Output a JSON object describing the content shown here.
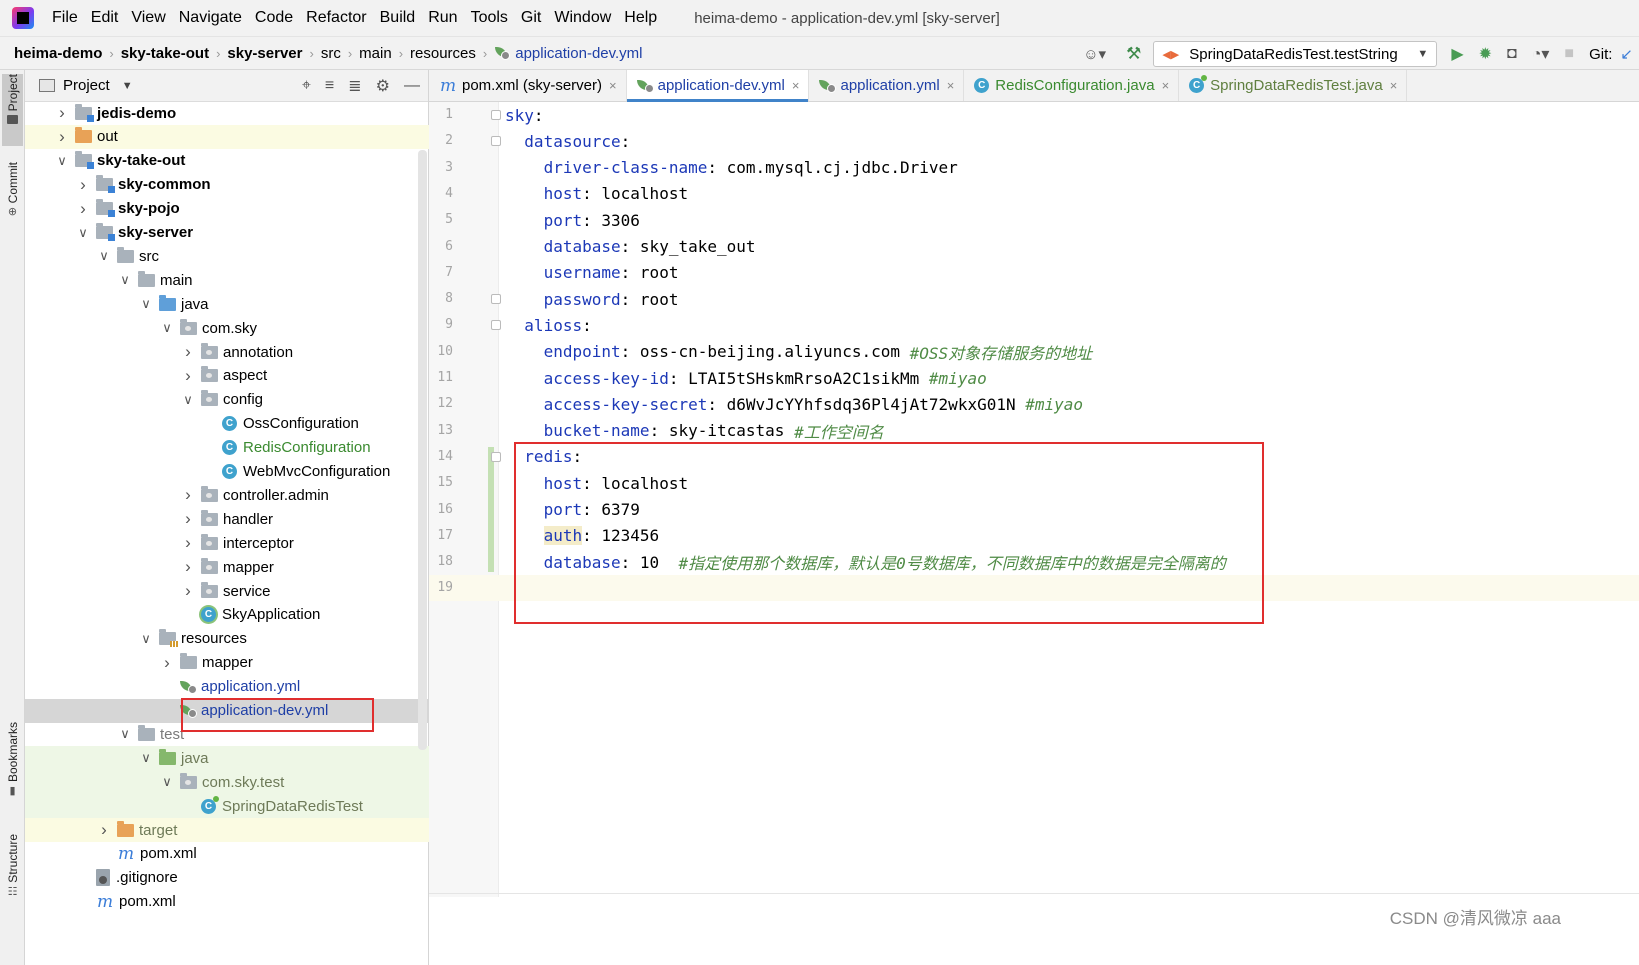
{
  "menubar": {
    "items": [
      "File",
      "Edit",
      "View",
      "Navigate",
      "Code",
      "Refactor",
      "Build",
      "Run",
      "Tools",
      "Git",
      "Window",
      "Help"
    ],
    "window_title": "heima-demo - application-dev.yml [sky-server]"
  },
  "navbar": {
    "breadcrumbs": [
      "heima-demo",
      "sky-take-out",
      "sky-server",
      "src",
      "main",
      "resources",
      "application-dev.yml"
    ],
    "run_config": "SpringDataRedisTest.testString",
    "git_label": "Git:"
  },
  "toolstrip": {
    "project": "Project",
    "commit": "Commit",
    "bookmarks": "Bookmarks",
    "structure": "Structure"
  },
  "project_panel": {
    "title": "Project",
    "tree": [
      {
        "label": "jedis-demo",
        "depth": 0,
        "arrow": "right",
        "icon": "module-folder",
        "style": "bold"
      },
      {
        "label": "out",
        "depth": 0,
        "arrow": "right",
        "icon": "orange-folder",
        "style": "normal",
        "bg": "yellow"
      },
      {
        "label": "sky-take-out",
        "depth": 0,
        "arrow": "down",
        "icon": "module-folder",
        "style": "bold"
      },
      {
        "label": "sky-common",
        "depth": 1,
        "arrow": "right",
        "icon": "module-folder",
        "style": "bold"
      },
      {
        "label": "sky-pojo",
        "depth": 1,
        "arrow": "right",
        "icon": "module-folder",
        "style": "bold"
      },
      {
        "label": "sky-server",
        "depth": 1,
        "arrow": "down",
        "icon": "module-folder",
        "style": "bold"
      },
      {
        "label": "src",
        "depth": 2,
        "arrow": "down",
        "icon": "folder",
        "style": "normal"
      },
      {
        "label": "main",
        "depth": 3,
        "arrow": "down",
        "icon": "folder",
        "style": "normal"
      },
      {
        "label": "java",
        "depth": 4,
        "arrow": "down",
        "icon": "blue-folder",
        "style": "normal"
      },
      {
        "label": "com.sky",
        "depth": 5,
        "arrow": "down",
        "icon": "package",
        "style": "normal"
      },
      {
        "label": "annotation",
        "depth": 6,
        "arrow": "right",
        "icon": "package",
        "style": "normal"
      },
      {
        "label": "aspect",
        "depth": 6,
        "arrow": "right",
        "icon": "package",
        "style": "normal"
      },
      {
        "label": "config",
        "depth": 6,
        "arrow": "down",
        "icon": "package",
        "style": "normal"
      },
      {
        "label": "OssConfiguration",
        "depth": 7,
        "arrow": "none",
        "icon": "class",
        "style": "normal"
      },
      {
        "label": "RedisConfiguration",
        "depth": 7,
        "arrow": "none",
        "icon": "class",
        "style": "green"
      },
      {
        "label": "WebMvcConfiguration",
        "depth": 7,
        "arrow": "none",
        "icon": "class",
        "style": "normal"
      },
      {
        "label": "controller.admin",
        "depth": 6,
        "arrow": "right",
        "icon": "package",
        "style": "normal"
      },
      {
        "label": "handler",
        "depth": 6,
        "arrow": "right",
        "icon": "package",
        "style": "normal"
      },
      {
        "label": "interceptor",
        "depth": 6,
        "arrow": "right",
        "icon": "package",
        "style": "normal"
      },
      {
        "label": "mapper",
        "depth": 6,
        "arrow": "right",
        "icon": "package",
        "style": "normal"
      },
      {
        "label": "service",
        "depth": 6,
        "arrow": "right",
        "icon": "package",
        "style": "normal"
      },
      {
        "label": "SkyApplication",
        "depth": 6,
        "arrow": "none",
        "icon": "spring-class",
        "style": "normal"
      },
      {
        "label": "resources",
        "depth": 4,
        "arrow": "down",
        "icon": "resources-folder",
        "style": "normal"
      },
      {
        "label": "mapper",
        "depth": 5,
        "arrow": "right",
        "icon": "folder",
        "style": "normal"
      },
      {
        "label": "application.yml",
        "depth": 5,
        "arrow": "none",
        "icon": "yml",
        "style": "blue"
      },
      {
        "label": "application-dev.yml",
        "depth": 5,
        "arrow": "none",
        "icon": "yml",
        "style": "blue",
        "bg": "selected"
      },
      {
        "label": "test",
        "depth": 3,
        "arrow": "down",
        "icon": "folder",
        "style": "gray"
      },
      {
        "label": "java",
        "depth": 4,
        "arrow": "down",
        "icon": "green-folder",
        "style": "olive",
        "bg": "green"
      },
      {
        "label": "com.sky.test",
        "depth": 5,
        "arrow": "down",
        "icon": "package",
        "style": "olive",
        "bg": "green"
      },
      {
        "label": "SpringDataRedisTest",
        "depth": 6,
        "arrow": "none",
        "icon": "test-class",
        "style": "olive",
        "bg": "green"
      },
      {
        "label": "target",
        "depth": 2,
        "arrow": "right",
        "icon": "orange-folder",
        "style": "olive",
        "bg": "yellow"
      },
      {
        "label": "pom.xml",
        "depth": 2,
        "arrow": "none",
        "icon": "maven",
        "style": "normal"
      },
      {
        "label": ".gitignore",
        "depth": 1,
        "arrow": "none",
        "icon": "gitignore",
        "style": "normal"
      },
      {
        "label": "pom.xml",
        "depth": 1,
        "arrow": "none",
        "icon": "maven",
        "style": "normal"
      }
    ]
  },
  "tabs": [
    {
      "label": "pom.xml (sky-server)",
      "icon": "maven",
      "style": "normal",
      "active": false
    },
    {
      "label": "application-dev.yml",
      "icon": "yml",
      "style": "blue",
      "active": true
    },
    {
      "label": "application.yml",
      "icon": "yml",
      "style": "blue",
      "active": false
    },
    {
      "label": "RedisConfiguration.java",
      "icon": "class",
      "style": "green",
      "active": false
    },
    {
      "label": "SpringDataRedisTest.java",
      "icon": "test-class",
      "style": "olive",
      "active": false
    }
  ],
  "editor": {
    "lines": [
      {
        "n": "1",
        "indent": 0,
        "key": "sky",
        "sep": ":",
        "value": "",
        "comment": ""
      },
      {
        "n": "2",
        "indent": 1,
        "key": "datasource",
        "sep": ":",
        "value": "",
        "comment": ""
      },
      {
        "n": "3",
        "indent": 2,
        "key": "driver-class-name",
        "sep": ": ",
        "value": "com.mysql.cj.jdbc.Driver",
        "comment": ""
      },
      {
        "n": "4",
        "indent": 2,
        "key": "host",
        "sep": ": ",
        "value": "localhost",
        "comment": ""
      },
      {
        "n": "5",
        "indent": 2,
        "key": "port",
        "sep": ": ",
        "value": "3306",
        "comment": ""
      },
      {
        "n": "6",
        "indent": 2,
        "key": "database",
        "sep": ": ",
        "value": "sky_take_out",
        "comment": ""
      },
      {
        "n": "7",
        "indent": 2,
        "key": "username",
        "sep": ": ",
        "value": "root",
        "comment": ""
      },
      {
        "n": "8",
        "indent": 2,
        "key": "password",
        "sep": ": ",
        "value": "root",
        "comment": ""
      },
      {
        "n": "9",
        "indent": 1,
        "key": "alioss",
        "sep": ":",
        "value": "",
        "comment": ""
      },
      {
        "n": "10",
        "indent": 2,
        "key": "endpoint",
        "sep": ": ",
        "value": "oss-cn-beijing.aliyuncs.com ",
        "comment": "#OSS对象存储服务的地址"
      },
      {
        "n": "11",
        "indent": 2,
        "key": "access-key-id",
        "sep": ": ",
        "value": "LTAI5tSHskmRrsoA2C1sikMm ",
        "comment": "#miyao"
      },
      {
        "n": "12",
        "indent": 2,
        "key": "access-key-secret",
        "sep": ": ",
        "value": "d6WvJcYYhfsdq36Pl4jAt72wkxG01N ",
        "comment": "#miyao"
      },
      {
        "n": "13",
        "indent": 2,
        "key": "bucket-name",
        "sep": ": ",
        "value": "sky-itcastas ",
        "comment": "#工作空间名"
      },
      {
        "n": "14",
        "indent": 1,
        "key": "redis",
        "sep": ":",
        "value": "",
        "comment": ""
      },
      {
        "n": "15",
        "indent": 2,
        "key": "host",
        "sep": ": ",
        "value": "localhost",
        "comment": ""
      },
      {
        "n": "16",
        "indent": 2,
        "key": "port",
        "sep": ": ",
        "value": "6379",
        "comment": ""
      },
      {
        "n": "17",
        "indent": 2,
        "key": "auth",
        "sep": ": ",
        "value": "123456",
        "comment": ""
      },
      {
        "n": "18",
        "indent": 2,
        "key": "database",
        "sep": ": ",
        "value": "10  ",
        "comment": "#指定使用那个数据库，默认是0号数据库，不同数据库中的数据是完全隔离的"
      },
      {
        "n": "19",
        "indent": 1,
        "key": "",
        "sep": "",
        "value": "",
        "comment": ""
      }
    ]
  },
  "watermark": "CSDN @清风微凉 aaa",
  "colors": {
    "yaml_key": "#1c38b7",
    "comment": "#4f8b45",
    "annotation_box": "#e02e2e",
    "active_tab_underline": "#4083c9"
  }
}
